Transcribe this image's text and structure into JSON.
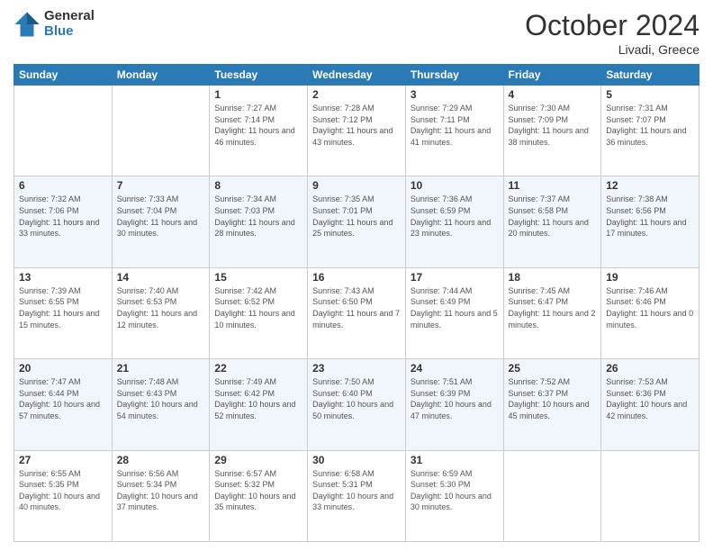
{
  "logo": {
    "general": "General",
    "blue": "Blue"
  },
  "header": {
    "month": "October 2024",
    "location": "Livadi, Greece"
  },
  "weekdays": [
    "Sunday",
    "Monday",
    "Tuesday",
    "Wednesday",
    "Thursday",
    "Friday",
    "Saturday"
  ],
  "weeks": [
    [
      {
        "day": "",
        "info": ""
      },
      {
        "day": "",
        "info": ""
      },
      {
        "day": "1",
        "info": "Sunrise: 7:27 AM\nSunset: 7:14 PM\nDaylight: 11 hours and 46 minutes."
      },
      {
        "day": "2",
        "info": "Sunrise: 7:28 AM\nSunset: 7:12 PM\nDaylight: 11 hours and 43 minutes."
      },
      {
        "day": "3",
        "info": "Sunrise: 7:29 AM\nSunset: 7:11 PM\nDaylight: 11 hours and 41 minutes."
      },
      {
        "day": "4",
        "info": "Sunrise: 7:30 AM\nSunset: 7:09 PM\nDaylight: 11 hours and 38 minutes."
      },
      {
        "day": "5",
        "info": "Sunrise: 7:31 AM\nSunset: 7:07 PM\nDaylight: 11 hours and 36 minutes."
      }
    ],
    [
      {
        "day": "6",
        "info": "Sunrise: 7:32 AM\nSunset: 7:06 PM\nDaylight: 11 hours and 33 minutes."
      },
      {
        "day": "7",
        "info": "Sunrise: 7:33 AM\nSunset: 7:04 PM\nDaylight: 11 hours and 30 minutes."
      },
      {
        "day": "8",
        "info": "Sunrise: 7:34 AM\nSunset: 7:03 PM\nDaylight: 11 hours and 28 minutes."
      },
      {
        "day": "9",
        "info": "Sunrise: 7:35 AM\nSunset: 7:01 PM\nDaylight: 11 hours and 25 minutes."
      },
      {
        "day": "10",
        "info": "Sunrise: 7:36 AM\nSunset: 6:59 PM\nDaylight: 11 hours and 23 minutes."
      },
      {
        "day": "11",
        "info": "Sunrise: 7:37 AM\nSunset: 6:58 PM\nDaylight: 11 hours and 20 minutes."
      },
      {
        "day": "12",
        "info": "Sunrise: 7:38 AM\nSunset: 6:56 PM\nDaylight: 11 hours and 17 minutes."
      }
    ],
    [
      {
        "day": "13",
        "info": "Sunrise: 7:39 AM\nSunset: 6:55 PM\nDaylight: 11 hours and 15 minutes."
      },
      {
        "day": "14",
        "info": "Sunrise: 7:40 AM\nSunset: 6:53 PM\nDaylight: 11 hours and 12 minutes."
      },
      {
        "day": "15",
        "info": "Sunrise: 7:42 AM\nSunset: 6:52 PM\nDaylight: 11 hours and 10 minutes."
      },
      {
        "day": "16",
        "info": "Sunrise: 7:43 AM\nSunset: 6:50 PM\nDaylight: 11 hours and 7 minutes."
      },
      {
        "day": "17",
        "info": "Sunrise: 7:44 AM\nSunset: 6:49 PM\nDaylight: 11 hours and 5 minutes."
      },
      {
        "day": "18",
        "info": "Sunrise: 7:45 AM\nSunset: 6:47 PM\nDaylight: 11 hours and 2 minutes."
      },
      {
        "day": "19",
        "info": "Sunrise: 7:46 AM\nSunset: 6:46 PM\nDaylight: 11 hours and 0 minutes."
      }
    ],
    [
      {
        "day": "20",
        "info": "Sunrise: 7:47 AM\nSunset: 6:44 PM\nDaylight: 10 hours and 57 minutes."
      },
      {
        "day": "21",
        "info": "Sunrise: 7:48 AM\nSunset: 6:43 PM\nDaylight: 10 hours and 54 minutes."
      },
      {
        "day": "22",
        "info": "Sunrise: 7:49 AM\nSunset: 6:42 PM\nDaylight: 10 hours and 52 minutes."
      },
      {
        "day": "23",
        "info": "Sunrise: 7:50 AM\nSunset: 6:40 PM\nDaylight: 10 hours and 50 minutes."
      },
      {
        "day": "24",
        "info": "Sunrise: 7:51 AM\nSunset: 6:39 PM\nDaylight: 10 hours and 47 minutes."
      },
      {
        "day": "25",
        "info": "Sunrise: 7:52 AM\nSunset: 6:37 PM\nDaylight: 10 hours and 45 minutes."
      },
      {
        "day": "26",
        "info": "Sunrise: 7:53 AM\nSunset: 6:36 PM\nDaylight: 10 hours and 42 minutes."
      }
    ],
    [
      {
        "day": "27",
        "info": "Sunrise: 6:55 AM\nSunset: 5:35 PM\nDaylight: 10 hours and 40 minutes."
      },
      {
        "day": "28",
        "info": "Sunrise: 6:56 AM\nSunset: 5:34 PM\nDaylight: 10 hours and 37 minutes."
      },
      {
        "day": "29",
        "info": "Sunrise: 6:57 AM\nSunset: 5:32 PM\nDaylight: 10 hours and 35 minutes."
      },
      {
        "day": "30",
        "info": "Sunrise: 6:58 AM\nSunset: 5:31 PM\nDaylight: 10 hours and 33 minutes."
      },
      {
        "day": "31",
        "info": "Sunrise: 6:59 AM\nSunset: 5:30 PM\nDaylight: 10 hours and 30 minutes."
      },
      {
        "day": "",
        "info": ""
      },
      {
        "day": "",
        "info": ""
      }
    ]
  ]
}
